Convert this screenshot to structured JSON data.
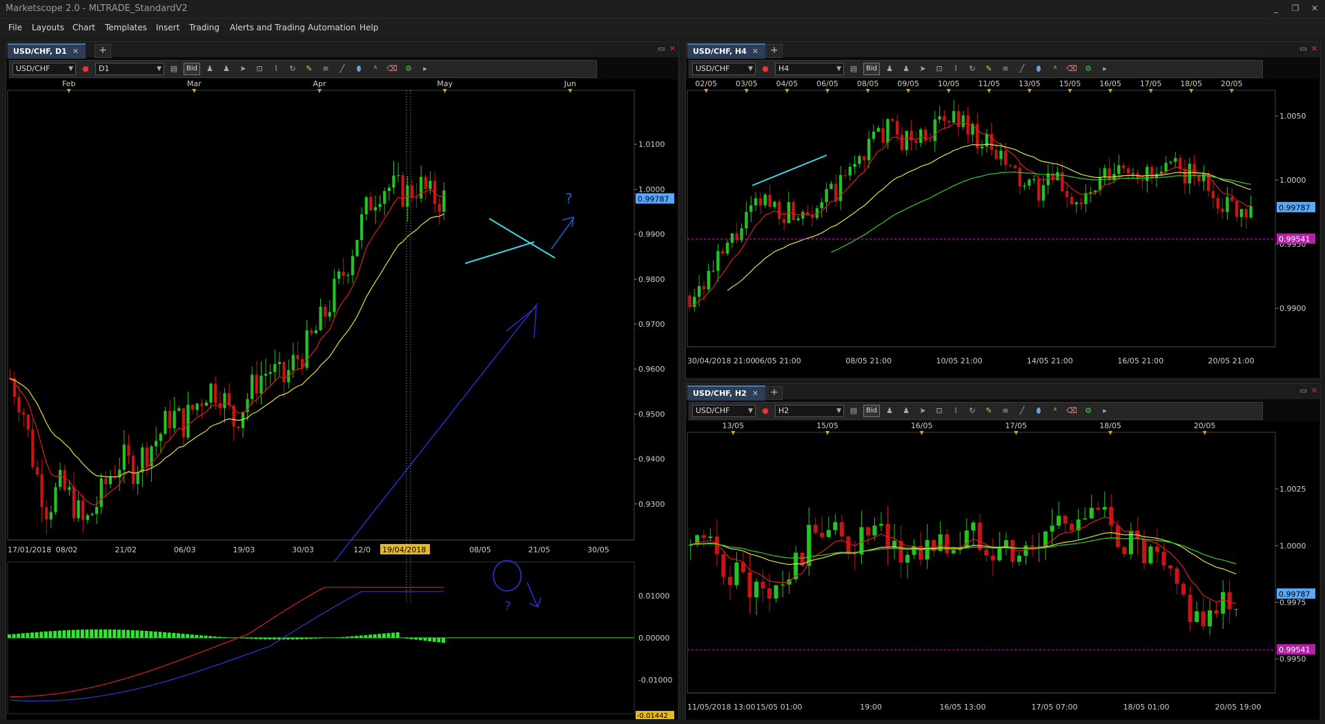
{
  "app": {
    "title": "Marketscope 2.0 - MLTRADE_StandardV2",
    "controls": [
      "_",
      "❐",
      "✕"
    ]
  },
  "menu": [
    "File",
    "Layouts",
    "Chart",
    "Templates",
    "Insert",
    "Trading",
    "Alerts and Trading Automation",
    "Help"
  ],
  "colors": {
    "bull": "#22c322",
    "bear": "#c81414",
    "ema_red": "#e01b1b",
    "ema_yellow": "#e8e23a",
    "ema_green": "#2fcf2f",
    "macd_red": "#e01b1b",
    "macd_blue": "#2b3bd6",
    "hist": "#2ee82e",
    "tab_active": "#2d3d55",
    "price_label": "#55aaff",
    "magenta_label": "#b520a8"
  },
  "panels": {
    "d1": {
      "tab": "USD/CHF, D1",
      "symbol": "USD/CHF",
      "timeframe": "D1",
      "bid": "Bid",
      "months": [
        "Feb",
        "Mar",
        "Apr",
        "May",
        "Jun"
      ],
      "price_ticks": [
        "1.0100",
        "1.0000",
        "0.9900",
        "0.9800",
        "0.9700",
        "0.9600",
        "0.9500",
        "0.9400",
        "0.9300"
      ],
      "current_price": "0.99787",
      "date_ticks": [
        "17/01/2018",
        "08/02",
        "21/02",
        "06/03",
        "19/03",
        "30/03",
        "12/0",
        "04",
        "08/05",
        "21/05",
        "30/05"
      ],
      "crosshair_date": "19/04/2018",
      "macd_ticks": [
        "0.01000",
        "0.00000",
        "-0.01000"
      ],
      "macd_value": "-0.01442",
      "annotations": [
        "?",
        "?"
      ]
    },
    "h4": {
      "tab": "USD/CHF, H4",
      "symbol": "USD/CHF",
      "timeframe": "H4",
      "bid": "Bid",
      "top_dates": [
        "02/05",
        "03/05",
        "04/05",
        "06/05",
        "08/05",
        "09/05",
        "10/05",
        "11/05",
        "13/05",
        "15/05",
        "16/05",
        "17/05",
        "18/05",
        "20/05"
      ],
      "price_ticks": [
        "1.0050",
        "1.0000",
        "0.9950",
        "0.9900"
      ],
      "current_price": "0.99787",
      "level_price": "0.99541",
      "date_ticks": [
        "30/04/2018 21:00",
        "06/05 21:00",
        "08/05 21:00",
        "10/05 21:00",
        "14/05 21:00",
        "16/05 21:00",
        "20/05 21:00"
      ]
    },
    "h2": {
      "tab": "USD/CHF, H2",
      "symbol": "USD/CHF",
      "timeframe": "H2",
      "bid": "Bid",
      "top_dates": [
        "13/05",
        "15/05",
        "16/05",
        "17/05",
        "18/05",
        "20/05"
      ],
      "price_ticks": [
        "1.0025",
        "1.0000",
        "0.9975",
        "0.9950"
      ],
      "current_price": "0.99787",
      "level_price": "0.99541",
      "date_ticks": [
        "11/05/2018 13:00",
        "15/05 01:00",
        "19:00",
        "16/05 13:00",
        "17/05 07:00",
        "18/05 01:00",
        "20/05 19:00"
      ]
    }
  },
  "chart_data": [
    {
      "type": "candlestick",
      "name": "",
      "ylim": [
        0.922,
        1.022
      ],
      "x_range": [
        "2018-01-17",
        "2018-06-02"
      ],
      "close_path": [
        0.958,
        0.952,
        0.938,
        0.929,
        0.934,
        0.931,
        0.925,
        0.93,
        0.936,
        0.94,
        0.938,
        0.942,
        0.945,
        0.95,
        0.948,
        0.952,
        0.956,
        0.955,
        0.948,
        0.953,
        0.958,
        0.96,
        0.957,
        0.962,
        0.965,
        0.97,
        0.976,
        0.982,
        0.99,
        0.997,
        1.001,
        1.0,
        0.999,
        1.001,
        0.998,
        0.99787
      ]
    },
    {
      "type": "candlestick",
      "name": "",
      "ylim": [
        0.987,
        1.007
      ],
      "x_range": [
        "2018-04-30 21:00",
        "2018-05-20 21:00"
      ],
      "close_path": [
        0.991,
        0.993,
        0.996,
        0.9985,
        0.9975,
        0.998,
        0.999,
        1.002,
        1.004,
        1.003,
        1.004,
        1.005,
        1.003,
        1.001,
        0.999,
        1.0,
        0.998,
        1.0,
        1.001,
        1.0,
        1.001,
        1.0,
        0.998,
        0.99787
      ]
    },
    {
      "type": "candlestick",
      "name": "",
      "ylim": [
        0.9935,
        1.005
      ],
      "x_range": [
        "2018-05-11 13:00",
        "2018-05-20 21:00"
      ],
      "close_path": [
        1.0,
        0.9995,
        0.9985,
        0.9975,
        0.999,
        1.001,
        1.0,
        1.0005,
        0.9995,
        1.0,
        1.0,
        1.0005,
        1.0,
        0.9995,
        1.001,
        1.0015,
        1.001,
        1.0,
        0.999,
        0.9975,
        0.9965,
        0.99787
      ]
    }
  ]
}
